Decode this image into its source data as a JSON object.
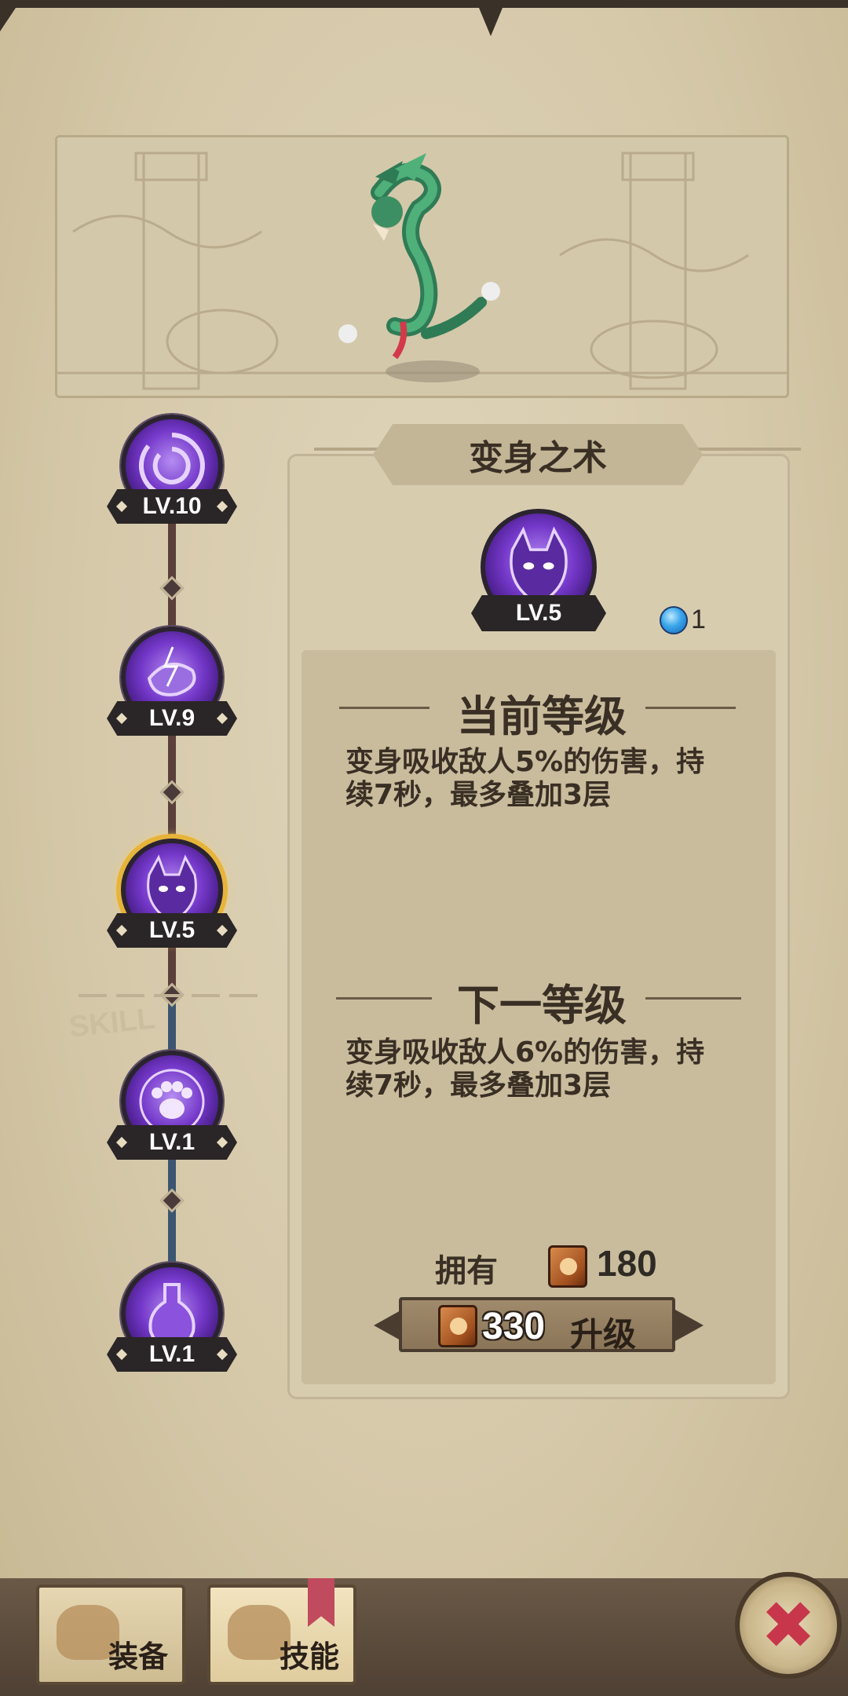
{
  "skill": {
    "title": "变身之术",
    "level_badge": "LV.5",
    "gem_count": "1"
  },
  "tree": {
    "nodes": [
      {
        "level": "LV.10",
        "icon": "vortex-icon"
      },
      {
        "level": "LV.9",
        "icon": "lightning-fist-icon"
      },
      {
        "level": "LV.5",
        "icon": "demon-cat-icon",
        "selected": true
      },
      {
        "level": "LV.1",
        "icon": "paw-seal-icon"
      },
      {
        "level": "LV.1",
        "icon": "potion-flask-icon"
      }
    ],
    "skill_label": "SKILL"
  },
  "current": {
    "heading": "当前等级",
    "desc": "变身吸收敌人5%的伤害，持续7秒，最多叠加3层"
  },
  "next": {
    "heading": "下一等级",
    "desc": "变身吸收敌人6%的伤害，持续7秒，最多叠加3层"
  },
  "owned": {
    "label": "拥有",
    "count": "180"
  },
  "upgrade": {
    "cost": "330",
    "label": "升级"
  },
  "tabs": [
    {
      "label": "装备"
    },
    {
      "label": "技能"
    }
  ],
  "close_icon": "✖",
  "colors": {
    "paper": "#d9cdb0",
    "orb_purple": "#7438c9",
    "selected_ring": "#e7b43a",
    "close_red": "#c7364b"
  }
}
